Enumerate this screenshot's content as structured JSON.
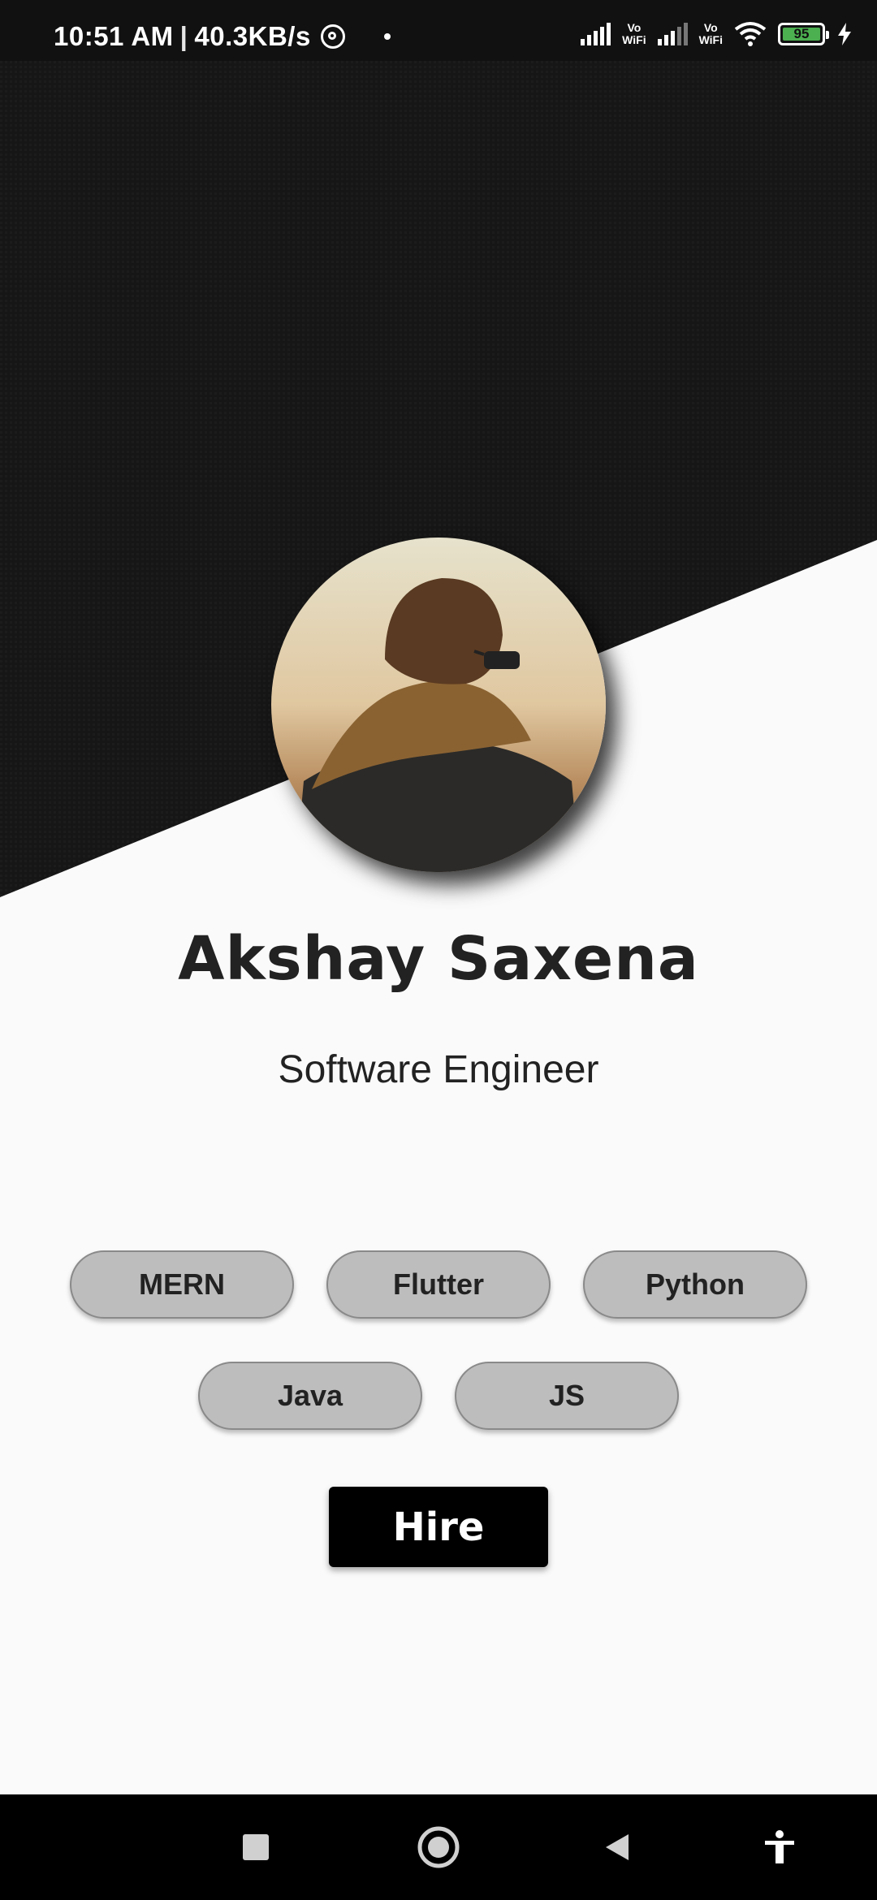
{
  "status_bar": {
    "time": "10:51 AM",
    "speed": "40.3KB/s",
    "vowifi_1": "Vo WiFi",
    "vowifi_2": "Vo WiFi",
    "battery": "95"
  },
  "profile": {
    "name": "Akshay Saxena",
    "title": "Software Engineer"
  },
  "skills": [
    "MERN",
    "Flutter",
    "Python",
    "Java",
    "JS"
  ],
  "actions": {
    "hire_label": "Hire"
  },
  "colors": {
    "dark": "#161616",
    "light": "#fafafa",
    "chip": "#bdbdbd",
    "button": "#000000"
  },
  "icons": {
    "nav_recents": "square-icon",
    "nav_home": "circle-icon",
    "nav_back": "triangle-back-icon",
    "nav_accessibility": "accessibility-icon"
  }
}
